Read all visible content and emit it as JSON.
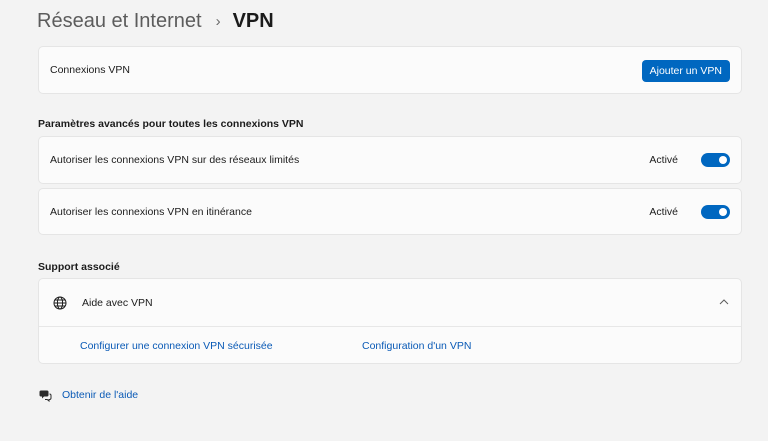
{
  "breadcrumb": {
    "parent": "Réseau et Internet",
    "separator": "›",
    "current": "VPN"
  },
  "vpn_connections": {
    "label": "Connexions VPN",
    "add_button": "Ajouter un VPN"
  },
  "advanced": {
    "title": "Paramètres avancés pour toutes les connexions VPN",
    "settings": [
      {
        "label": "Autoriser les connexions VPN sur des réseaux limités",
        "state": "Activé",
        "on": true
      },
      {
        "label": "Autoriser les connexions VPN en itinérance",
        "state": "Activé",
        "on": true
      }
    ]
  },
  "support": {
    "title": "Support associé",
    "help_label": "Aide avec VPN",
    "expanded": true,
    "links": [
      "Configurer une connexion VPN sécurisée",
      "Configuration d'un VPN"
    ]
  },
  "get_help": "Obtenir de l'aide",
  "colors": {
    "accent": "#0067c0",
    "link": "#0a5ab6",
    "background": "#f3f3f3",
    "card": "#fbfbfb"
  },
  "icons": {
    "breadcrumb_separator": "chevron-right-icon",
    "help": "globe-icon",
    "collapse": "chevron-up-icon",
    "get_help": "help-chat-icon"
  }
}
